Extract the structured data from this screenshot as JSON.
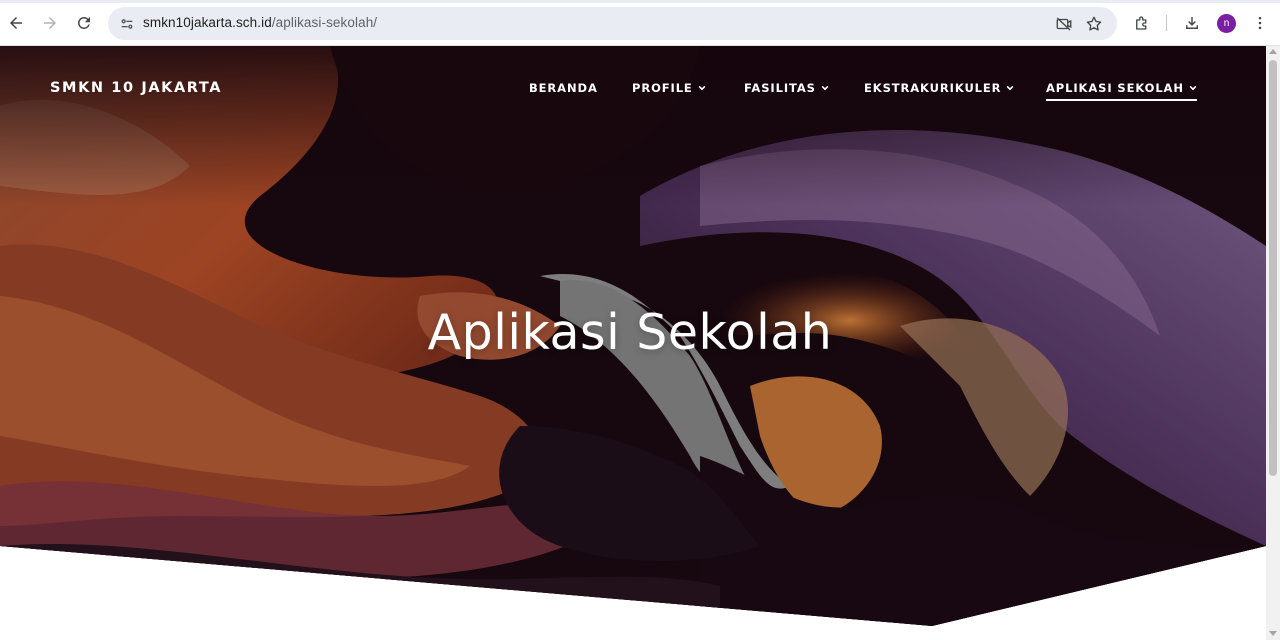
{
  "browser": {
    "url_domain": "smkn10jakarta.sch.id",
    "url_path": "/aplikasi-sekolah/",
    "profile_initial": "n",
    "icons": [
      "back-icon",
      "forward-icon",
      "reload-icon",
      "site-info-icon",
      "camera-blocked-icon",
      "star-icon",
      "extensions-icon",
      "download-icon",
      "menu-icon"
    ]
  },
  "site": {
    "brand": "SMKN 10 JAKARTA",
    "nav": [
      {
        "label": "BERANDA",
        "dropdown": false
      },
      {
        "label": "PROFILE",
        "dropdown": true
      },
      {
        "label": "FASILITAS",
        "dropdown": true
      },
      {
        "label": "EKSTRAKURIKULER",
        "dropdown": true
      },
      {
        "label": "APLIKASI SEKOLAH",
        "dropdown": true,
        "active": true
      }
    ],
    "hero_title": "Aplikasi Sekolah"
  },
  "colors": {
    "accent_avatar": "#7b1fa2",
    "hero_dark": "#1a0a10",
    "rock_orange": "#c2512a",
    "rock_purple": "#6d4c8a",
    "sky": "#8a8a8a"
  }
}
